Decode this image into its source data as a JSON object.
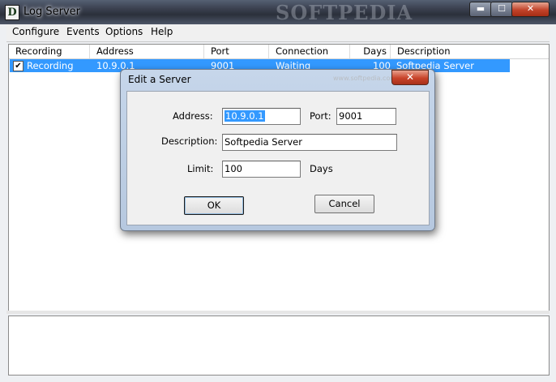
{
  "window": {
    "title": "Log Server",
    "app_icon_letter": "D"
  },
  "titlebar": {
    "minimize": "▬",
    "maximize": "☐",
    "close": "✕"
  },
  "menu": [
    "Configure",
    "Events",
    "Options",
    "Help"
  ],
  "list": {
    "columns": [
      "Recording",
      "Address",
      "Port",
      "Connection",
      "Days",
      "Description"
    ],
    "rows": [
      {
        "checked": true,
        "recording": "Recording",
        "address": "10.9.0.1",
        "port": "9001",
        "connection": "Waiting",
        "days": "100",
        "description": "Softpedia Server"
      }
    ]
  },
  "dialog": {
    "title": "Edit a Server",
    "close": "✕",
    "address_label": "Address:",
    "address_value": "10.9.0.1",
    "port_label": "Port:",
    "port_value": "9001",
    "description_label": "Description:",
    "description_value": "Softpedia Server",
    "limit_label": "Limit:",
    "limit_value": "100",
    "days_label": "Days",
    "ok_label": "OK",
    "cancel_label": "Cancel"
  },
  "watermark": {
    "text": "SOFTPEDIA",
    "url": "www.softpedia.com"
  }
}
